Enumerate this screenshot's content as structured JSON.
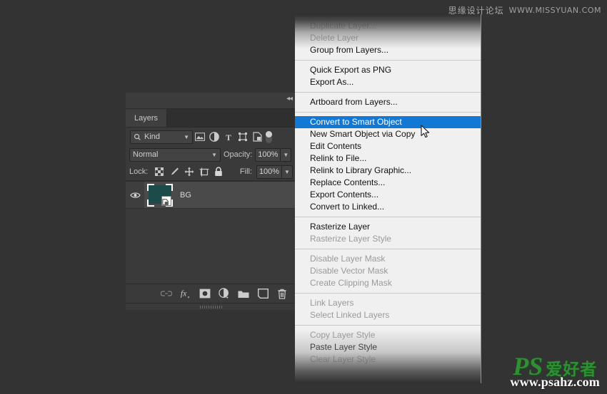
{
  "watermarks": {
    "top_cn": "思缘设计论坛",
    "top_url": "WWW.MISSYUAN.COM",
    "bottom_ps": "PS",
    "bottom_cn": "爱好者",
    "bottom_url": "www.psahz.com"
  },
  "layers_panel": {
    "tab_label": "Layers",
    "collapse_icon": "collapse-panel-icon",
    "filter": {
      "search_icon": "search-icon",
      "kind_label": "Kind",
      "chevron": "chevron-down-icon",
      "icons": [
        {
          "name": "filter-pixel-layers-icon",
          "glyph": "image"
        },
        {
          "name": "filter-adjustment-layers-icon",
          "glyph": "halfcircle"
        },
        {
          "name": "filter-type-layers-icon",
          "glyph": "T"
        },
        {
          "name": "filter-shape-layers-icon",
          "glyph": "shape"
        },
        {
          "name": "filter-smart-objects-icon",
          "glyph": "smart"
        }
      ],
      "toggle_name": "filter-enable-toggle"
    },
    "blend": {
      "mode_value": "Normal",
      "opacity_label": "Opacity:",
      "opacity_value": "100%"
    },
    "lock": {
      "label": "Lock:",
      "fill_label": "Fill:",
      "fill_value": "100%",
      "icons": [
        {
          "name": "lock-transparent-pixels-icon"
        },
        {
          "name": "lock-image-pixels-icon"
        },
        {
          "name": "lock-position-icon"
        },
        {
          "name": "lock-artboard-nesting-icon"
        },
        {
          "name": "lock-all-icon"
        }
      ]
    },
    "layer": {
      "visibility_icon": "eye-icon",
      "name": "BG",
      "thumbnail_color": "#1d4a4a",
      "smart_object_badge": "smart-object-badge-icon"
    },
    "bottom_icons": [
      {
        "name": "link-layers-icon"
      },
      {
        "name": "layer-style-fx-icon"
      },
      {
        "name": "add-layer-mask-icon"
      },
      {
        "name": "new-adjustment-layer-icon"
      },
      {
        "name": "new-group-icon"
      },
      {
        "name": "new-layer-icon"
      },
      {
        "name": "delete-layer-icon"
      }
    ]
  },
  "context_menu": {
    "selected_item": "Convert to Smart Object",
    "highlight_color": "#1278d4",
    "groups": [
      {
        "items": [
          {
            "label": "Duplicate Layer...",
            "state": "faded"
          },
          {
            "label": "Delete Layer",
            "state": "faded"
          },
          {
            "label": "Group from Layers...",
            "state": "enabled"
          }
        ]
      },
      {
        "items": [
          {
            "label": "Quick Export as PNG",
            "state": "enabled"
          },
          {
            "label": "Export As...",
            "state": "enabled"
          }
        ]
      },
      {
        "items": [
          {
            "label": "Artboard from Layers...",
            "state": "enabled"
          }
        ]
      },
      {
        "items": [
          {
            "label": "Convert to Smart Object",
            "state": "selected"
          },
          {
            "label": "New Smart Object via Copy",
            "state": "enabled"
          },
          {
            "label": "Edit Contents",
            "state": "enabled"
          },
          {
            "label": "Relink to File...",
            "state": "enabled"
          },
          {
            "label": "Relink to Library Graphic...",
            "state": "enabled"
          },
          {
            "label": "Replace Contents...",
            "state": "enabled"
          },
          {
            "label": "Export Contents...",
            "state": "enabled"
          },
          {
            "label": "Convert to Linked...",
            "state": "enabled"
          }
        ]
      },
      {
        "items": [
          {
            "label": "Rasterize Layer",
            "state": "enabled"
          },
          {
            "label": "Rasterize Layer Style",
            "state": "disabled"
          }
        ]
      },
      {
        "items": [
          {
            "label": "Disable Layer Mask",
            "state": "disabled"
          },
          {
            "label": "Disable Vector Mask",
            "state": "disabled"
          },
          {
            "label": "Create Clipping Mask",
            "state": "disabled"
          }
        ]
      },
      {
        "items": [
          {
            "label": "Link Layers",
            "state": "disabled"
          },
          {
            "label": "Select Linked Layers",
            "state": "disabled"
          }
        ]
      },
      {
        "items": [
          {
            "label": "Copy Layer Style",
            "state": "disabled"
          },
          {
            "label": "Paste Layer Style",
            "state": "enabled"
          },
          {
            "label": "Clear Layer Style",
            "state": "faded"
          }
        ]
      }
    ],
    "cursor_icon": "mouse-pointer-cursor"
  }
}
